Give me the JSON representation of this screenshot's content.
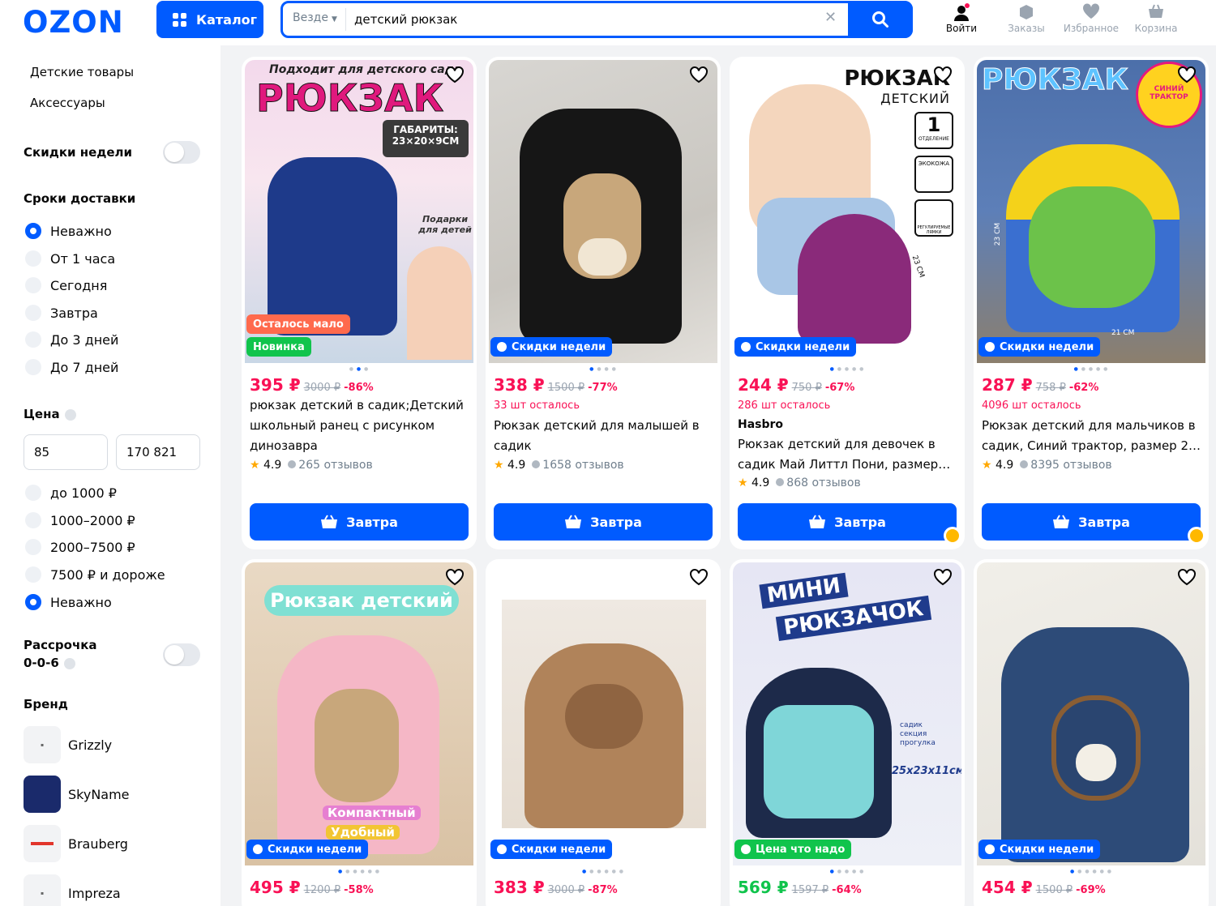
{
  "header": {
    "logo": "OZON",
    "catalog_label": "Каталог",
    "search_scope": "Везде",
    "search_value": "детский рюкзак",
    "nav": [
      {
        "label": "Войти",
        "icon": "user-icon"
      },
      {
        "label": "Заказы",
        "icon": "box-icon"
      },
      {
        "label": "Избранное",
        "icon": "heart-icon"
      },
      {
        "label": "Корзина",
        "icon": "cart-icon"
      }
    ]
  },
  "sidebar": {
    "links": [
      "Детские товары",
      "Аксессуары"
    ],
    "weekly_discounts": "Скидки недели",
    "delivery": {
      "title": "Сроки доставки",
      "options": [
        "Неважно",
        "От 1 часа",
        "Сегодня",
        "Завтра",
        "До 3 дней",
        "До 7 дней"
      ],
      "selected": 0
    },
    "price": {
      "title": "Цена",
      "from": "85",
      "to": "170 821",
      "options": [
        "до 1000 ₽",
        "1000–2000 ₽",
        "2000–7500 ₽",
        "7500 ₽ и дороже",
        "Неважно"
      ],
      "selected": 4
    },
    "installment": {
      "line1": "Рассрочка",
      "line2": "0-0-6"
    },
    "brand": {
      "title": "Бренд",
      "items": [
        "Grizzly",
        "SkyName",
        "Brauberg",
        "Impreza"
      ]
    }
  },
  "colors": {
    "accent": "#005bff",
    "price": "#f91155",
    "badge_weekly": "#005bff",
    "badge_new": "#10c44c",
    "badge_low": "#ff6a4d",
    "badge_price": "#10c44c"
  },
  "products": [
    {
      "image_text": [
        "Подходит для детского сада",
        "РЮКЗАК",
        "ГАБАРИТЫ:",
        "23×20×9СМ",
        "Подарки для детей"
      ],
      "badges": [
        {
          "text": "Осталось мало",
          "kind": "low"
        },
        {
          "text": "Новинка",
          "kind": "new"
        }
      ],
      "price": "395 ₽",
      "old_price": "3000 ₽",
      "discount": "-86%",
      "stock": "",
      "brand": "",
      "title": "рюкзак детский в садик;Детский школьный ранец с рисунком динозавра",
      "rating": "4.9",
      "reviews": "265 отзывов",
      "button": "Завтра"
    },
    {
      "image_text": [],
      "badges": [
        {
          "text": "Скидки недели",
          "kind": "weekly"
        }
      ],
      "price": "338 ₽",
      "old_price": "1500 ₽",
      "discount": "-77%",
      "stock": "33 шт осталось",
      "brand": "",
      "title": "Рюкзак детский для малышей в садик",
      "rating": "4.9",
      "reviews": "1658 отзывов",
      "button": "Завтра"
    },
    {
      "image_text": [
        "РЮКЗАК",
        "ДЕТСКИЙ",
        "1",
        "ОТДЕЛЕНИЕ",
        "ЭКОКОЖА",
        "РЕГУЛИРУЕМЫЕ ЛЯМКИ",
        "23 СМ"
      ],
      "badges": [
        {
          "text": "Скидки недели",
          "kind": "weekly"
        }
      ],
      "price": "244 ₽",
      "old_price": "750 ₽",
      "discount": "-67%",
      "stock": "286 шт осталось",
      "brand": "Hasbro",
      "title": "Рюкзак детский для девочек в садик Май Литтл Пони, размер…",
      "rating": "4.9",
      "reviews": "868 отзывов",
      "button": "Завтра"
    },
    {
      "image_text": [
        "РЮКЗАК",
        "СИНИЙ ТРАКТОР",
        "23 СМ",
        "21 СМ"
      ],
      "badges": [
        {
          "text": "Скидки недели",
          "kind": "weekly"
        }
      ],
      "price": "287 ₽",
      "old_price": "758 ₽",
      "discount": "-62%",
      "stock": "4096 шт осталось",
      "brand": "",
      "title": "Рюкзак детский для мальчиков в садик, Синий трактор, размер 2…",
      "rating": "4.9",
      "reviews": "8395 отзывов",
      "button": "Завтра"
    },
    {
      "image_text": [
        "Рюкзак детский",
        "Компактный",
        "Удобный"
      ],
      "badges": [
        {
          "text": "Скидки недели",
          "kind": "weekly"
        }
      ],
      "price": "495 ₽",
      "old_price": "1200 ₽",
      "discount": "-58%"
    },
    {
      "image_text": [],
      "badges": [
        {
          "text": "Скидки недели",
          "kind": "weekly"
        }
      ],
      "price": "383 ₽",
      "old_price": "3000 ₽",
      "discount": "-87%"
    },
    {
      "image_text": [
        "МИНИ",
        "РЮКЗАЧОК",
        "садик",
        "секция",
        "прогулка",
        "25x23x11см."
      ],
      "badges": [
        {
          "text": "Цена что надо",
          "kind": "price"
        }
      ],
      "price": "569 ₽",
      "old_price": "1597 ₽",
      "discount": "-64%"
    },
    {
      "image_text": [],
      "badges": [
        {
          "text": "Скидки недели",
          "kind": "weekly"
        }
      ],
      "price": "454 ₽",
      "old_price": "1500 ₽",
      "discount": "-69%"
    }
  ]
}
